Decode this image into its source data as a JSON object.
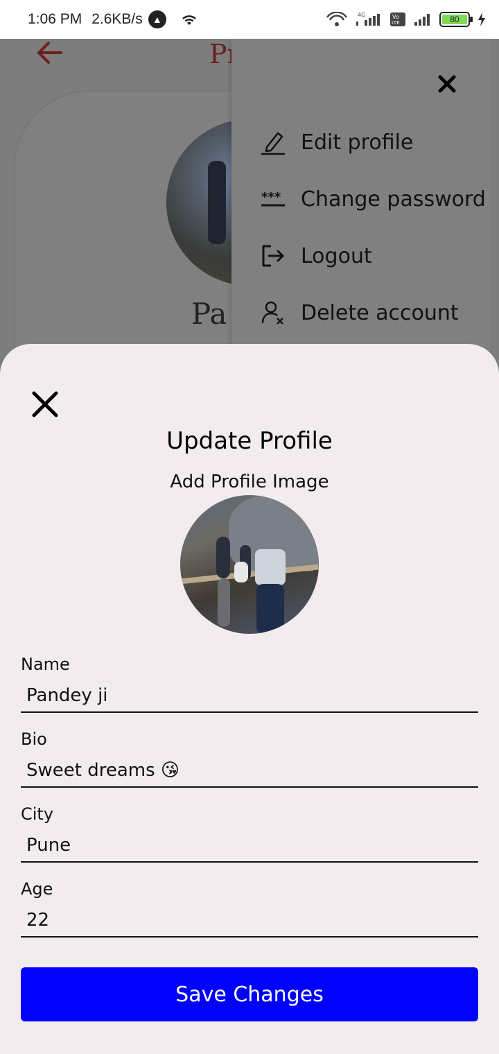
{
  "status_bar": {
    "time": "1:06 PM",
    "speed": "2.6KB/s",
    "battery": "80",
    "network": "4G",
    "volte": "Vo LTE"
  },
  "background": {
    "title_partial": "Pr",
    "name_partial": "Pa"
  },
  "menu": {
    "items": [
      {
        "label": "Edit profile",
        "icon": "pencil-icon"
      },
      {
        "label": "Change password",
        "icon": "password-icon"
      },
      {
        "label": "Logout",
        "icon": "logout-icon"
      },
      {
        "label": "Delete account",
        "icon": "delete-user-icon"
      }
    ]
  },
  "sheet": {
    "title": "Update Profile",
    "subtitle": "Add Profile Image",
    "fields": [
      {
        "label": "Name",
        "value": "Pandey ji"
      },
      {
        "label": "Bio",
        "value": "Sweet dreams 😘"
      },
      {
        "label": "City",
        "value": "Pune"
      },
      {
        "label": "Age",
        "value": "22"
      }
    ],
    "save_label": "Save Changes"
  },
  "colors": {
    "accent": "#0000ff",
    "sheet_bg": "#f3ecee",
    "overlay": "#7d7d7d",
    "back_arrow": "#6b1f1f"
  }
}
